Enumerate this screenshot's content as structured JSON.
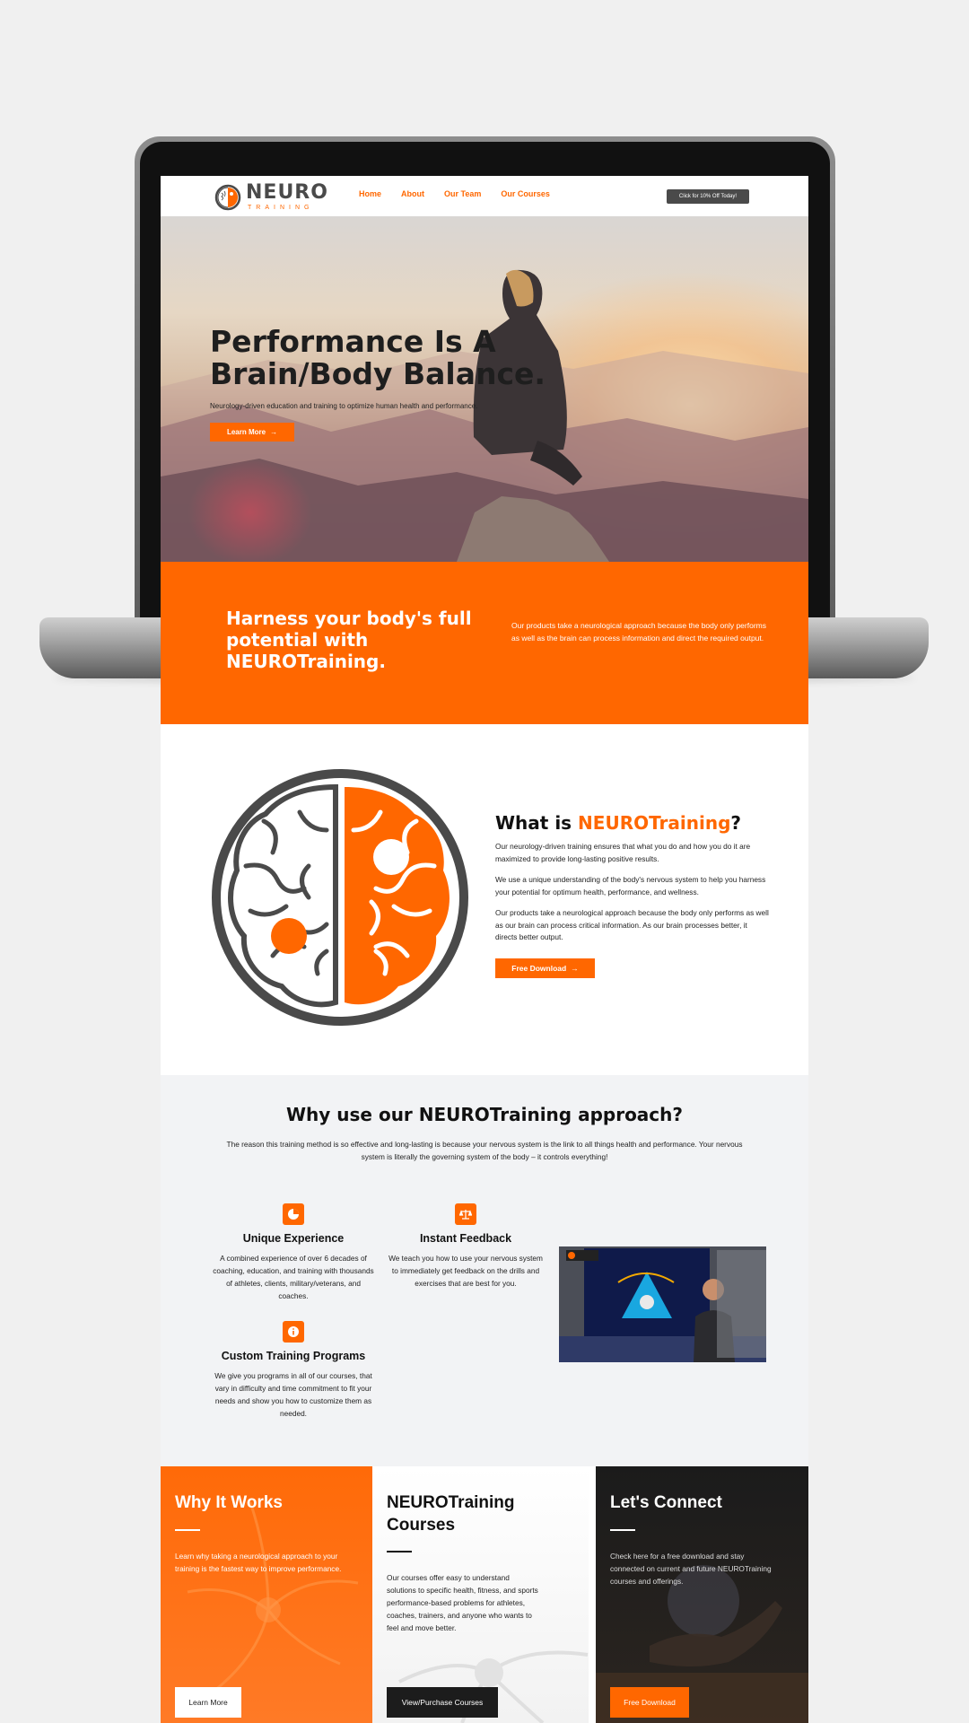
{
  "header": {
    "logo_word": "NEURO",
    "logo_sub": "TRAINING",
    "nav": [
      "Home",
      "About",
      "Our Team",
      "Our Courses"
    ],
    "cta": "Click for 10% Off Today!"
  },
  "hero": {
    "title_line1": "Performance Is A",
    "title_line2": "Brain/Body Balance.",
    "subtitle": "Neurology-driven education and training to optimize human health and performance.",
    "button": "Learn More"
  },
  "band": {
    "title": "Harness your body's full potential with NEUROTraining.",
    "text": "Our products take a neurological approach because the body only performs as well as the brain can process information and direct the required output."
  },
  "whatis": {
    "title_prefix": "What is ",
    "title_highlight": "NEUROTraining",
    "title_suffix": "?",
    "p1": "Our neurology-driven training ensures that what you do and how you do it are maximized to provide long-lasting positive results.",
    "p2": "We use a unique understanding of the body's nervous system to help you harness your potential for optimum health, performance, and wellness.",
    "p3": "Our products take a neurological approach because the body only performs as well as our brain can process critical information. As our brain processes better, it directs better output.",
    "button": "Free Download"
  },
  "why": {
    "title": "Why use our NEUROTraining approach?",
    "subtitle": "The reason this training method is so effective and long-lasting is because your nervous system is the link to all things health and performance. Your nervous system is literally the governing system of the body – it controls everything!",
    "features": [
      {
        "icon": "pie-chart-icon",
        "title": "Unique Experience",
        "text": "A combined experience of over 6 decades of coaching, education, and training with thousands of athletes, clients, military/veterans, and coaches."
      },
      {
        "icon": "scale-icon",
        "title": "Instant Feedback",
        "text": "We teach you how to use your nervous system to immediately get feedback on the drills and exercises that are best for you."
      },
      {
        "icon": "info-icon",
        "title": "Custom Training Programs",
        "text": "We give you programs in all of our courses, that vary in difficulty and time commitment to fit your needs and show you how to customize them as needed."
      }
    ]
  },
  "cards": [
    {
      "title": "Why It Works",
      "text": "Learn why taking a neurological approach to your training is the fastest way to improve performance.",
      "button": "Learn More"
    },
    {
      "title": "NEUROTraining Courses",
      "text": "Our courses offer easy to understand solutions to specific health, fitness, and sports performance-based problems for athletes, coaches, trainers, and anyone who wants to feel and move better.",
      "button": "View/Purchase Courses"
    },
    {
      "title": "Let's Connect",
      "text": "Check here for a free download and stay connected on current and future NEUROTraining courses and offerings.",
      "button": "Free Download"
    }
  ],
  "colors": {
    "accent": "#ff6700",
    "dark": "#4a4a4a",
    "section_bg": "#f2f3f5"
  }
}
